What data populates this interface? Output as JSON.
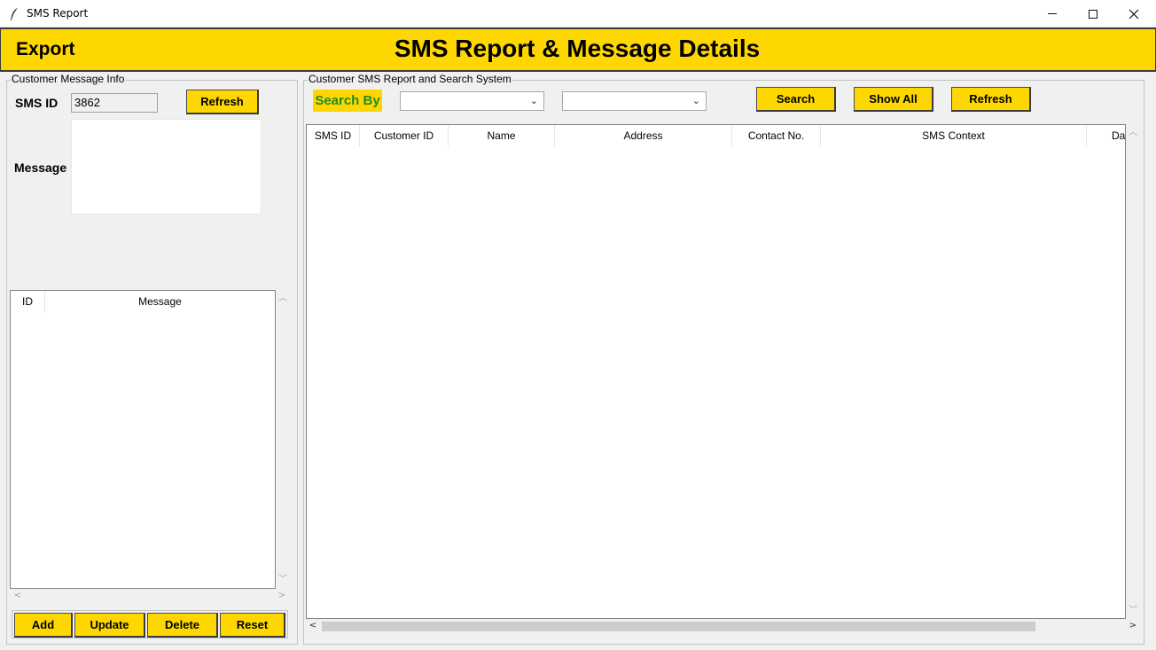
{
  "window": {
    "title": "SMS Report",
    "app_icon": "feather-icon",
    "controls": [
      "minimize-icon",
      "maximize-icon",
      "close-icon"
    ]
  },
  "header": {
    "export_label": "Export",
    "title": "SMS Report & Message Details",
    "background": "#ffd700"
  },
  "left_panel": {
    "frame_label": "Customer Message Info",
    "sms_id_label": "SMS ID",
    "sms_id_value": "3862",
    "refresh_label": "Refresh",
    "message_label": "Message",
    "message_value": "",
    "table": {
      "columns": [
        "ID",
        "Message"
      ],
      "rows": []
    },
    "buttons": {
      "add": "Add",
      "update": "Update",
      "delete": "Delete",
      "reset": "Reset"
    }
  },
  "right_panel": {
    "frame_label": "Customer SMS Report and Search System",
    "search_by_label": "Search By",
    "search_field_value": "",
    "search_text_value": "",
    "search_label": "Search",
    "show_all_label": "Show All",
    "refresh_label": "Refresh",
    "table": {
      "columns": [
        "SMS ID",
        "Customer ID",
        "Name",
        "Address",
        "Contact No.",
        "SMS Context",
        "Da"
      ],
      "rows": []
    }
  },
  "colors": {
    "accent": "#ffd700",
    "search_by_text": "#228b22"
  }
}
